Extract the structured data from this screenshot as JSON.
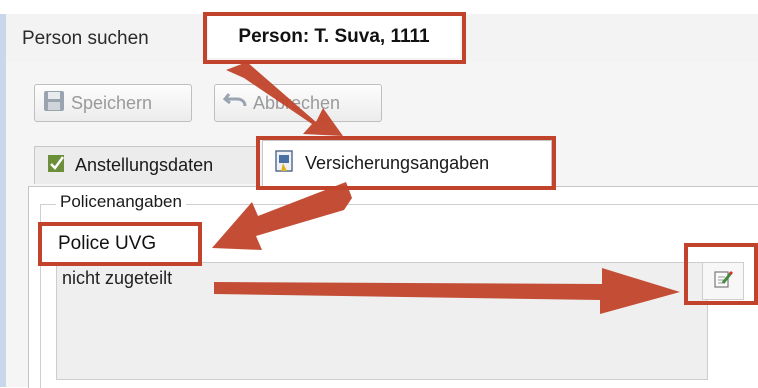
{
  "window": {
    "doc_tabs": [
      {
        "label": "Person suchen"
      },
      {
        "label": "Person: T. Suva, 1111"
      }
    ]
  },
  "toolbar": {
    "save_label": "Speichern",
    "undo_label": "Abbrechen"
  },
  "inner_tabs": [
    {
      "label": "Anstellungsdaten"
    },
    {
      "label": "Versicherungsangaben"
    }
  ],
  "group": {
    "title": "Policenangaben",
    "field_label": "Police UVG",
    "field_value": "nicht zugeteilt"
  },
  "colors": {
    "callout": "#c1432b"
  }
}
